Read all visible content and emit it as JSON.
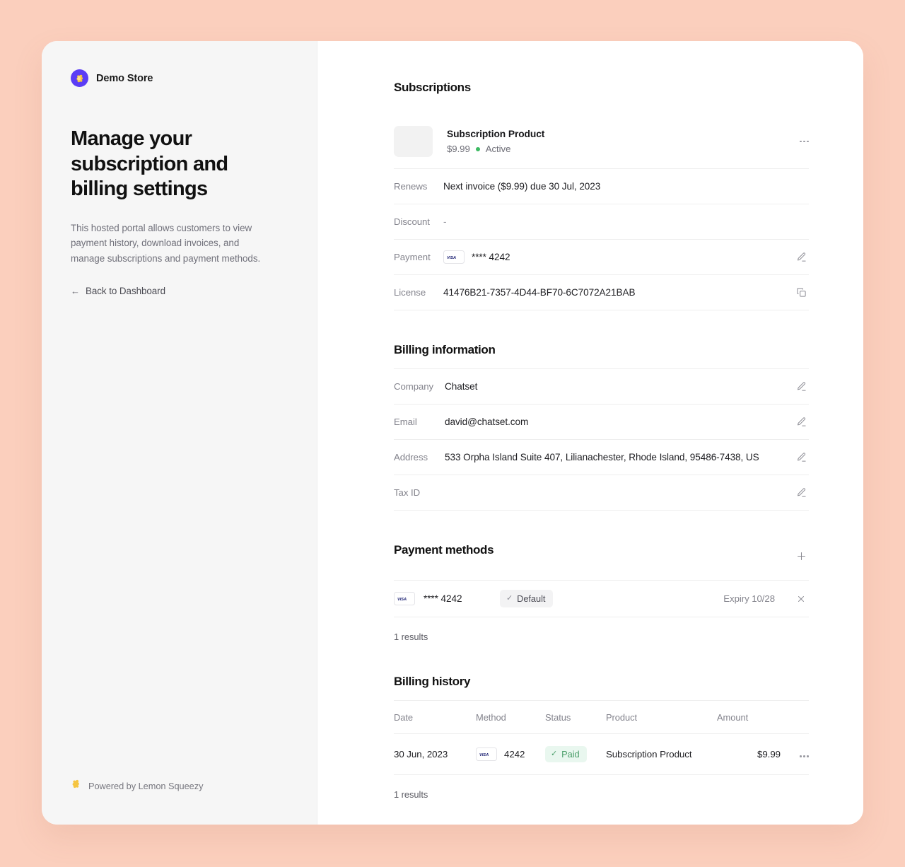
{
  "theme": {
    "page_background": "#fbcfbd",
    "card_background": "#ffffff",
    "sidebar_background": "#f6f6f6",
    "brand_accent": "#5b3df5",
    "status_active": "#3cba62",
    "status_paid_text": "#4b9e6a",
    "status_paid_bg": "#e9f7ef"
  },
  "sidebar": {
    "store_name": "Demo Store",
    "store_avatar_icon": "lemon-icon",
    "headline": "Manage your subscription and billing settings",
    "intro": "This hosted portal allows customers to view payment history, download invoices, and manage subscriptions and payment methods.",
    "back_link": {
      "arrow": "←",
      "label": "Back to Dashboard"
    },
    "powered_by": "Powered by Lemon Squeezy"
  },
  "subscriptions": {
    "title": "Subscriptions",
    "product": {
      "name": "Subscription Product",
      "price": "$9.99",
      "status": "Active"
    },
    "rows": [
      {
        "label": "Renews",
        "value": "Next invoice ($9.99) due 30 Jul, 2023",
        "action": "none"
      },
      {
        "label": "Discount",
        "value": "-",
        "action": "none"
      },
      {
        "label": "Payment",
        "value": "**** 4242",
        "card_brand": "VISA",
        "action": "edit"
      },
      {
        "label": "License",
        "value": "41476B21-7357-4D44-BF70-6C7072A21BAB",
        "action": "copy"
      }
    ]
  },
  "billing_information": {
    "title": "Billing information",
    "rows": [
      {
        "label": "Company",
        "value": "Chatset"
      },
      {
        "label": "Email",
        "value": "david@chatset.com"
      },
      {
        "label": "Address",
        "value": "533 Orpha Island Suite 407, Lilianachester, Rhode Island, 95486-7438, US"
      },
      {
        "label": "Tax ID",
        "value": ""
      }
    ]
  },
  "payment_methods": {
    "title": "Payment methods",
    "add_icon": "plus-icon",
    "items": [
      {
        "card_brand": "VISA",
        "number": "**** 4242",
        "default_label": "Default",
        "expiry": "Expiry 10/28"
      }
    ],
    "results": "1 results"
  },
  "billing_history": {
    "title": "Billing history",
    "columns": [
      "Date",
      "Method",
      "Status",
      "Product",
      "Amount"
    ],
    "rows": [
      {
        "date": "30 Jun, 2023",
        "card_brand": "VISA",
        "method": "4242",
        "status": "Paid",
        "product": "Subscription Product",
        "amount": "$9.99"
      }
    ],
    "results": "1 results"
  }
}
